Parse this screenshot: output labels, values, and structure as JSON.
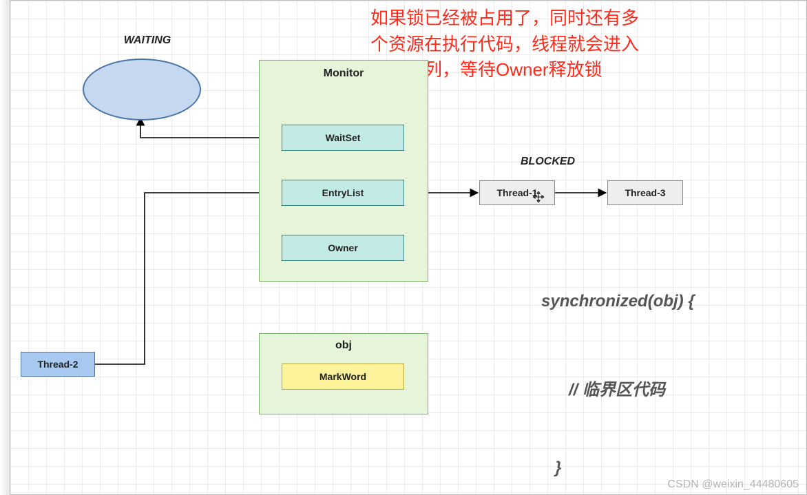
{
  "labels": {
    "waiting": "WAITING",
    "blocked": "BLOCKED",
    "monitor": "Monitor",
    "obj": "obj",
    "waitset": "WaitSet",
    "entrylist": "EntryList",
    "owner": "Owner",
    "markword": "MarkWord",
    "thread2": "Thread-2",
    "thread1": "Thread-1",
    "thread3": "Thread-3"
  },
  "annotation": {
    "line1": "如果锁已经被占用了，同时还有多",
    "line2": "个资源在执行代码，线程就会进入",
    "line3": "阻塞队列，等待Owner释放锁"
  },
  "code": {
    "l1": "synchronized(obj) {",
    "l2": "// 临界区代码",
    "l3": "}"
  },
  "watermark": "CSDN @weixin_44480605",
  "colors": {
    "green_fill": "#e6f4d9",
    "green_border": "#7aaf6a",
    "teal_fill": "#c2ebe5",
    "blue_fill": "#a7c8ef",
    "yellow_fill": "#fdf39a",
    "grey_fill": "#eeeeee",
    "red_text": "#ff2a1a"
  }
}
